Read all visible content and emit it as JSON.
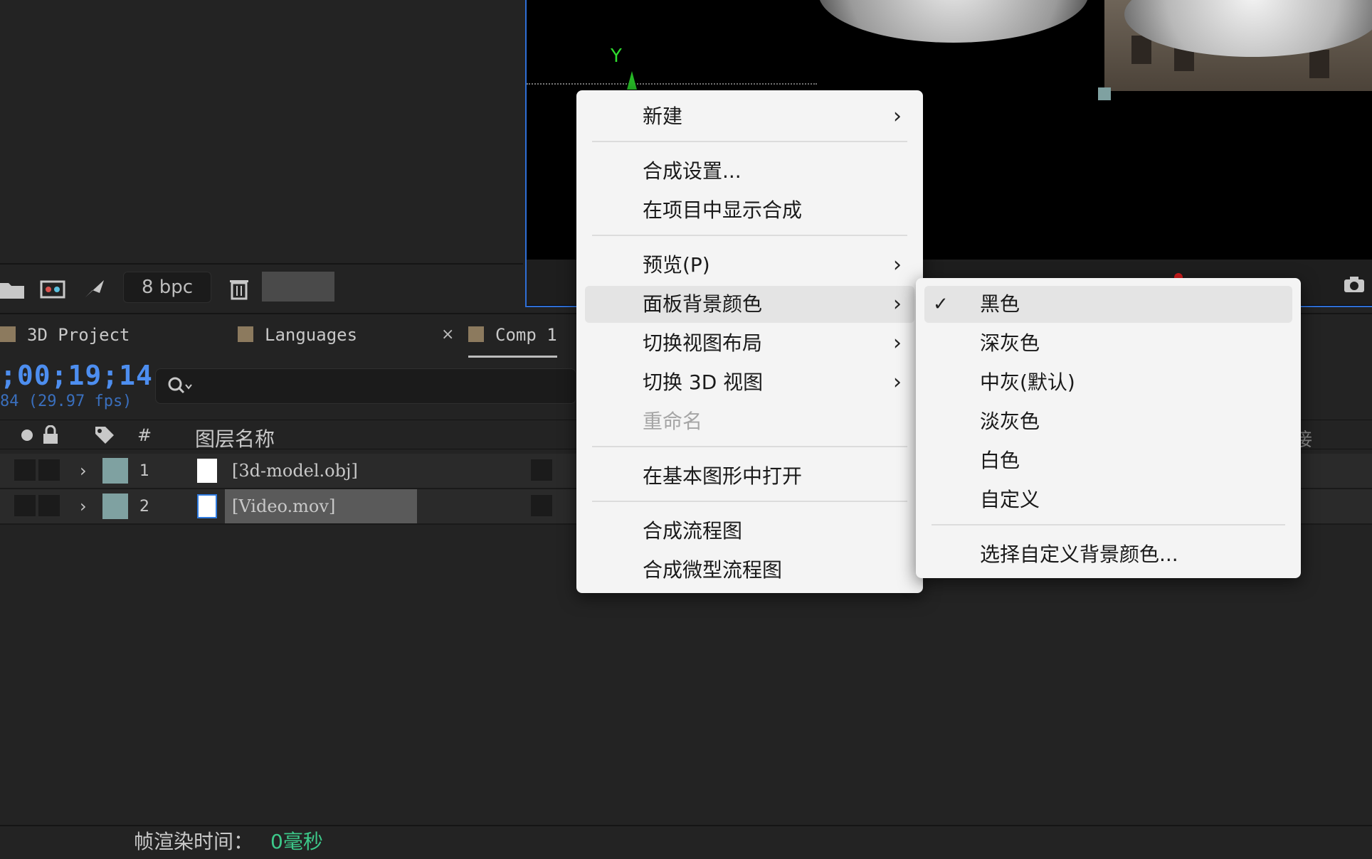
{
  "project_panel": {
    "bit_depth": "8 bpc"
  },
  "viewer": {
    "axis_label": "Y"
  },
  "tabs": [
    {
      "label": "3D Project"
    },
    {
      "label": "Languages"
    },
    {
      "label": "Comp 1"
    }
  ],
  "tab_close": "×",
  "timeline": {
    "timecode": ";00;19;14",
    "fps_info": "84 (29.97 fps)",
    "columns": {
      "hash": "#",
      "layer_name": "图层名称",
      "right_partial": "接"
    },
    "layers": [
      {
        "number": "1",
        "name": "[3d-model.obj]"
      },
      {
        "number": "2",
        "name": "[Video.mov]"
      }
    ]
  },
  "status_bar": {
    "render_time_label": "帧渲染时间：",
    "render_time_value": "0毫秒"
  },
  "context_menu": {
    "items": [
      {
        "label": "新建",
        "submenu": true
      },
      {
        "label": "合成设置..."
      },
      {
        "label": "在项目中显示合成"
      },
      {
        "label": "预览(P)",
        "submenu": true
      },
      {
        "label": "面板背景颜色",
        "submenu": true
      },
      {
        "label": "切换视图布局",
        "submenu": true
      },
      {
        "label": "切换 3D 视图",
        "submenu": true
      },
      {
        "label": "重命名",
        "disabled": true
      },
      {
        "label": "在基本图形中打开"
      },
      {
        "label": "合成流程图"
      },
      {
        "label": "合成微型流程图"
      }
    ],
    "chevron": "›"
  },
  "submenu": {
    "items": [
      {
        "label": "黑色",
        "checked": true
      },
      {
        "label": "深灰色"
      },
      {
        "label": "中灰(默认)"
      },
      {
        "label": "淡灰色"
      },
      {
        "label": "白色"
      },
      {
        "label": "自定义"
      },
      {
        "label": "选择自定义背景颜色..."
      }
    ],
    "checkmark": "✓"
  },
  "colors": {
    "timecode": "#4d8ef0",
    "render_value": "#3cc98a",
    "viewer_border": "#2f6fd6",
    "layer_label": "#7fa1a1",
    "menu_bg": "#f4f4f4"
  }
}
